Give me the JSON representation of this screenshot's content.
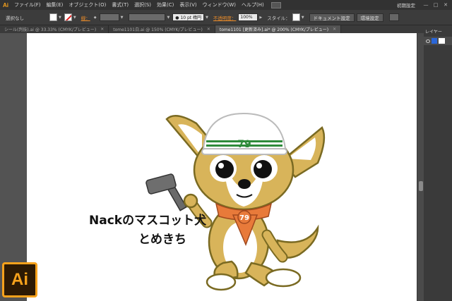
{
  "app": {
    "logo": "Ai",
    "big_logo": "Ai"
  },
  "menu": {
    "items": [
      "ファイル(F)",
      "編集(E)",
      "オブジェクト(O)",
      "書式(T)",
      "選択(S)",
      "効果(C)",
      "表示(V)",
      "ウィンドウ(W)",
      "ヘルプ(H)"
    ],
    "workspace": "初期設定",
    "min": "—",
    "max": "□",
    "close": "✕"
  },
  "control": {
    "selection": "選択なし",
    "stroke_label": "線：",
    "stroke_weight_arrow": "◆",
    "stroke_preset": "● 10 pt 楕円",
    "opacity_label": "不透明度：",
    "opacity_value": "100%",
    "style_label": "スタイル：",
    "doc_setup": "ドキュメント設定",
    "prefs": "環境設定"
  },
  "tabs": [
    {
      "label": "シール(判抜).ai @ 33.33% (CMYK/プレビュー)",
      "active": false
    },
    {
      "label": "tome1101白.ai @ 150% (CMYK/プレビュー)",
      "active": false
    },
    {
      "label": "tome1101 [更新済み].ai* @ 200% (CMYK/プレビュー)",
      "active": true
    }
  ],
  "tab_close": "✕",
  "panel": {
    "title": "レイヤー"
  },
  "artwork": {
    "caption_line1": "Nackのマスコット犬",
    "caption_line2": "とめきち",
    "helmet_text": "79",
    "scarf_text": "79"
  },
  "colors": {
    "dog_fur": "#d8b45a",
    "dog_outline": "#7a6a22",
    "helmet": "#ffffff",
    "helmet_stripe": "#2e8a3a",
    "scarf": "#e87a3a",
    "ai_brand": "#f7a21c"
  }
}
